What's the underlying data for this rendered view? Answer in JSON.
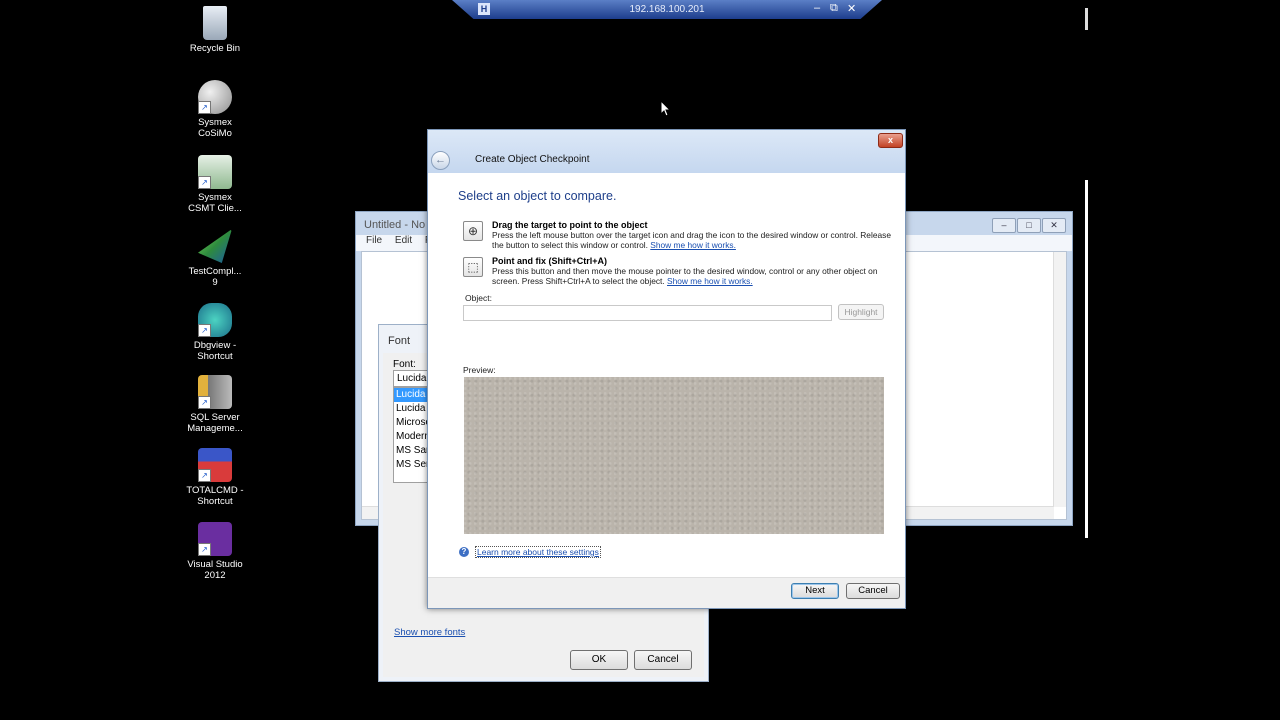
{
  "rdp_bar": {
    "ip": "192.168.100.201",
    "pin": "H",
    "minimize": "–",
    "restore": "⧉",
    "close": "✕"
  },
  "desktop_icons": [
    {
      "label": "Recycle Bin",
      "icon": "recycle-bin-icon"
    },
    {
      "label": "Sysmex CoSiMo",
      "icon": "sysmex-cosimo-icon"
    },
    {
      "label": "Sysmex CSMT Clie...",
      "icon": "sysmex-csmt-icon"
    },
    {
      "label": "TestCompl... 9",
      "icon": "testcomplete-icon"
    },
    {
      "label": "Dbgview - Shortcut",
      "icon": "dbgview-icon"
    },
    {
      "label": "SQL Server Manageme...",
      "icon": "sql-server-icon"
    },
    {
      "label": "TOTALCMD - Shortcut",
      "icon": "totalcmd-icon"
    },
    {
      "label": "Visual Studio 2012",
      "icon": "visual-studio-icon"
    }
  ],
  "notepad": {
    "title": "Untitled - No",
    "menu": [
      "File",
      "Edit",
      "Fo"
    ]
  },
  "font_dialog": {
    "title": "Font",
    "font_label": "Font:",
    "font_input": "Lucida C",
    "font_list": [
      "Lucida",
      "Lucida",
      "Microso",
      "Modern",
      "MS San",
      "MS Seri"
    ],
    "show_more": "Show more fonts",
    "ok": "OK",
    "cancel": "Cancel"
  },
  "wizard": {
    "title": "Create Object Checkpoint",
    "close": "x",
    "heading": "Select an object to compare.",
    "option1": {
      "title": "Drag the target to point to the object",
      "desc": "Press the left mouse button over the target icon and drag the icon to the desired window or control. Release the button to select this window or control.",
      "link": "Show me how it works."
    },
    "option2": {
      "title": "Point and fix (Shift+Ctrl+A)",
      "desc": "Press this button and then move the mouse pointer to the desired window, control or any other object on screen. Press Shift+Ctrl+A to select the object.",
      "link": "Show me how it works."
    },
    "object_label": "Object:",
    "object_value": "",
    "highlight": "Highlight",
    "preview_label": "Preview:",
    "learn_more": "Learn more about these settings",
    "next": "Next",
    "cancel": "Cancel"
  }
}
